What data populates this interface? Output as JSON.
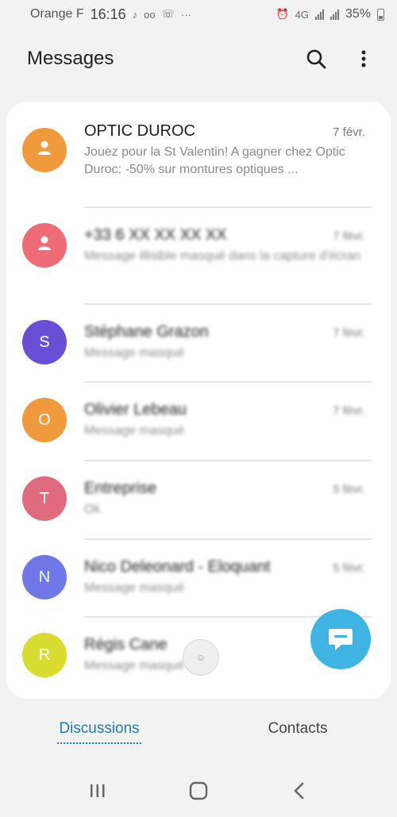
{
  "status_bar": {
    "carrier": "Orange F",
    "time": "16:16",
    "network": "4G",
    "battery": "35%"
  },
  "header": {
    "title": "Messages",
    "search_icon": "search-icon",
    "menu_icon": "more-vert-icon"
  },
  "conversations": [
    {
      "name": "OPTIC DUROC",
      "date": "7 févr.",
      "preview": "Jouez pour la St Valentin!  A gagner chez Optic Duroc: -50% sur montures optiques ...",
      "initial": "",
      "color": "#ef9b3d",
      "blurred": false
    },
    {
      "name": "+33 6 XX XX XX XX",
      "date": "7 févr.",
      "preview": "Message illisible masqué dans la capture d'écran",
      "initial": "",
      "color": "#ef6b78",
      "blurred": true
    },
    {
      "name": "Stéphane Grazon",
      "date": "7 févr.",
      "preview": "Message masqué",
      "initial": "S",
      "color": "#6a4fd6",
      "blurred": true
    },
    {
      "name": "Olivier Lebeau",
      "date": "7 févr.",
      "preview": "Message masqué",
      "initial": "O",
      "color": "#ef9b3d",
      "blurred": true
    },
    {
      "name": "Entreprise",
      "date": "5 févr.",
      "preview": "Ok",
      "initial": "T",
      "color": "#e06b7f",
      "blurred": true
    },
    {
      "name": "Nico Deleonard - Eloquant",
      "date": "5 févr.",
      "preview": "Message masqué",
      "initial": "N",
      "color": "#6e78e6",
      "blurred": true
    },
    {
      "name": "Régis Cane",
      "date": "",
      "preview": "Message masqué",
      "initial": "R",
      "color": "#d7dc2e",
      "blurred": true
    }
  ],
  "tabs": [
    {
      "label": "Discussions",
      "active": true
    },
    {
      "label": "Contacts",
      "active": false
    }
  ],
  "nav": {
    "recents": "recents-icon",
    "home": "home-icon",
    "back": "back-icon"
  },
  "fab": {
    "icon": "new-message-icon",
    "color": "#3fb4e3"
  }
}
